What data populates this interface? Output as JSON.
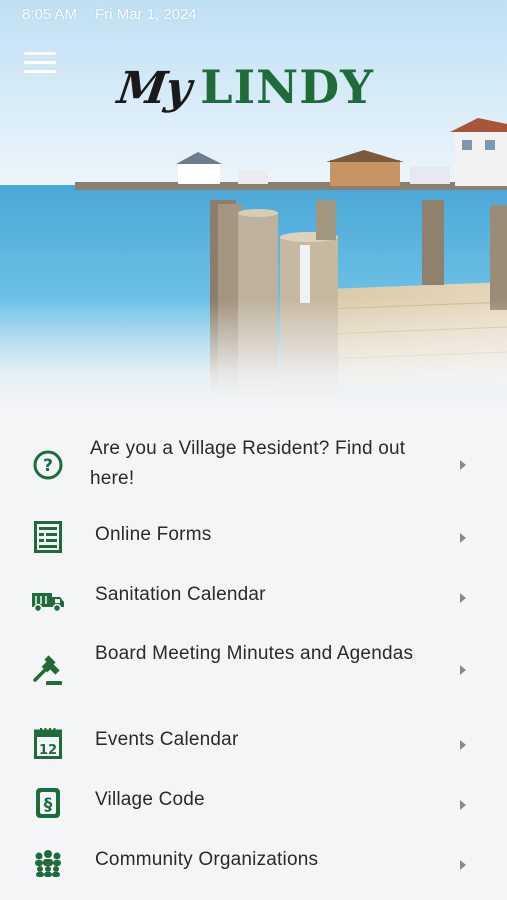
{
  "status_bar": {
    "time": "8:05 AM",
    "date": "Fri Mar 1, 2024"
  },
  "logo": {
    "script": "My",
    "main": "LINDY"
  },
  "colors": {
    "brand_green": "#1f6b3a",
    "background": "#f3f5f7",
    "chevron": "#8a8a8a"
  },
  "menu": [
    {
      "label": "Are you a Village Resident? Find out here!",
      "icon": "question-circle-icon"
    },
    {
      "label": "Online Forms",
      "icon": "form-icon"
    },
    {
      "label": "Sanitation Calendar",
      "icon": "garbage-truck-icon"
    },
    {
      "label": "Board Meeting Minutes and Agendas",
      "icon": "gavel-icon"
    },
    {
      "label": "Events Calendar",
      "icon": "calendar-icon"
    },
    {
      "label": "Village Code",
      "icon": "section-sign-icon"
    },
    {
      "label": "Community Organizations",
      "icon": "people-group-icon"
    }
  ]
}
